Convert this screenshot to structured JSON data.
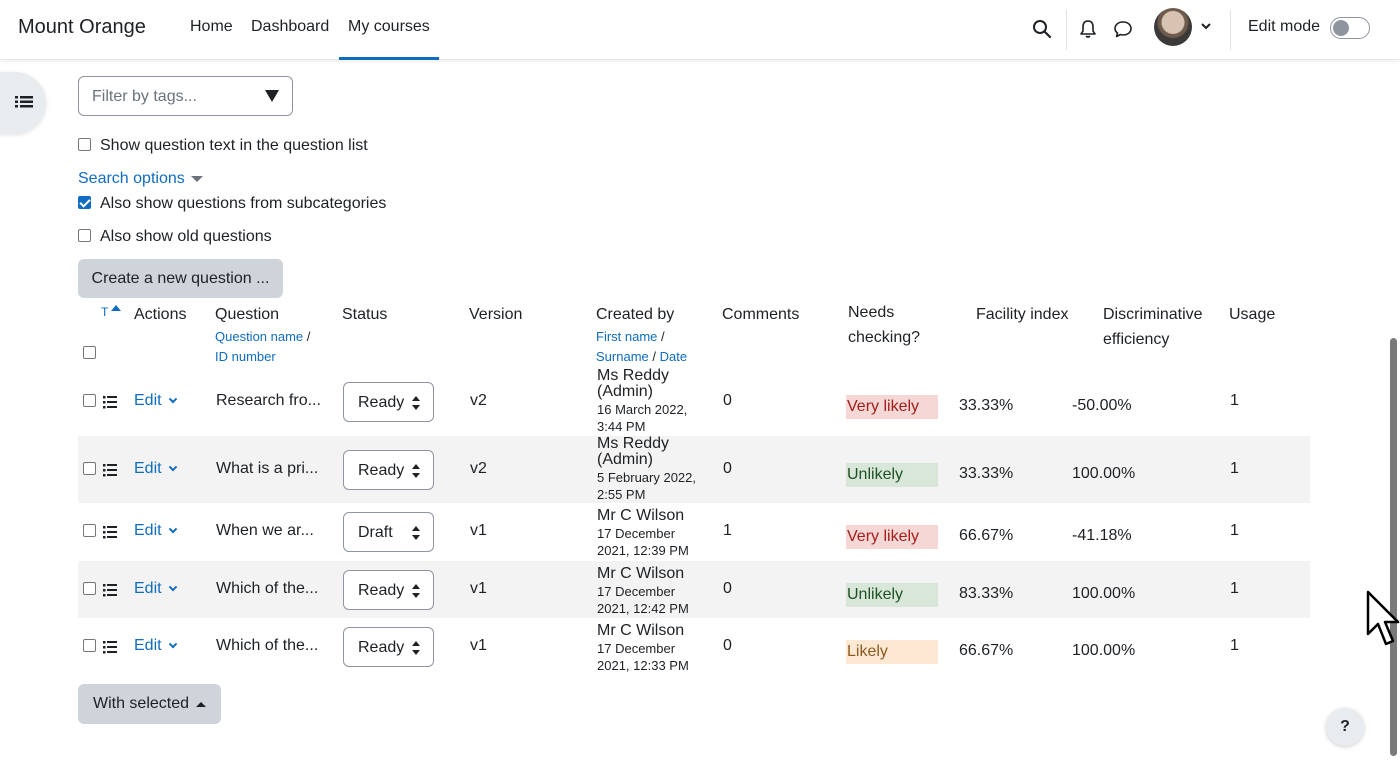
{
  "navbar": {
    "brand": "Mount Orange",
    "links": [
      {
        "label": "Home"
      },
      {
        "label": "Dashboard"
      },
      {
        "label": "My courses",
        "active": true
      }
    ],
    "icons": [
      "search-icon",
      "bell-icon",
      "message-icon"
    ],
    "edit_mode_label": "Edit mode",
    "edit_mode_on": false
  },
  "filters": {
    "tags_placeholder": "Filter by tags...",
    "show_question_text": {
      "label": "Show question text in the question list",
      "checked": false
    },
    "search_options_label": "Search options",
    "subcategories": {
      "label": "Also show questions from subcategories",
      "checked": true
    },
    "old_questions": {
      "label": "Also show old questions",
      "checked": false
    }
  },
  "create_button": "Create a new question ...",
  "table": {
    "sort_indicator": "T",
    "headers": {
      "actions": "Actions",
      "question": "Question",
      "question_sub_name": "Question name",
      "question_sub_sep": " /",
      "question_sub_id": "ID number",
      "status": "Status",
      "version": "Version",
      "created_by": "Created by",
      "created_sub_first": "First name",
      "created_sub_sep1": " /",
      "created_sub_surname": "Surname",
      "created_sub_sep2": " / ",
      "created_sub_date": "Date",
      "comments": "Comments",
      "needs_checking_1": "Needs",
      "needs_checking_2": "checking?",
      "facility_index": "Facility index",
      "disc_eff_1": "Discriminative",
      "disc_eff_2": "efficiency",
      "usage": "Usage"
    },
    "rows": [
      {
        "edit": "Edit",
        "question": "Research fro...",
        "status": "Ready",
        "version": "v2",
        "creator_1": "Ms Reddy",
        "creator_2": "(Admin)",
        "date_1": "16 March 2022,",
        "date_2": "3:44 PM",
        "comments": "0",
        "needs_checking": "Very likely",
        "nc_color": "#f5d7d6",
        "facility": "33.33%",
        "disc": "-50.00%",
        "usage": "1"
      },
      {
        "edit": "Edit",
        "question": "What is a pri...",
        "status": "Ready",
        "version": "v2",
        "creator_1": "Ms Reddy",
        "creator_2": "(Admin)",
        "date_1": "5 February 2022,",
        "date_2": "2:55 PM",
        "comments": "0",
        "needs_checking": "Unlikely",
        "nc_color": "#d8e7d9",
        "facility": "33.33%",
        "disc": "100.00%",
        "usage": "1"
      },
      {
        "edit": "Edit",
        "question": "When we ar...",
        "status": "Draft",
        "version": "v1",
        "creator_1": "Mr C Wilson",
        "creator_2": "",
        "date_1": "17 December",
        "date_2": "2021, 12:39 PM",
        "comments": "1",
        "needs_checking": "Very likely",
        "nc_color": "#f5d7d6",
        "facility": "66.67%",
        "disc": "-41.18%",
        "usage": "1"
      },
      {
        "edit": "Edit",
        "question": "Which of the...",
        "status": "Ready",
        "version": "v1",
        "creator_1": "Mr C Wilson",
        "creator_2": "",
        "date_1": "17 December",
        "date_2": "2021, 12:42 PM",
        "comments": "0",
        "needs_checking": "Unlikely",
        "nc_color": "#d8e7d9",
        "facility": "83.33%",
        "disc": "100.00%",
        "usage": "1"
      },
      {
        "edit": "Edit",
        "question": "Which of the...",
        "status": "Ready",
        "version": "v1",
        "creator_1": "Mr C Wilson",
        "creator_2": "",
        "date_1": "17 December",
        "date_2": "2021, 12:33 PM",
        "comments": "0",
        "needs_checking": "Likely",
        "nc_color": "#fde8d4",
        "facility": "66.67%",
        "disc": "100.00%",
        "usage": "1"
      }
    ]
  },
  "with_selected": "With selected",
  "help_label": "?"
}
